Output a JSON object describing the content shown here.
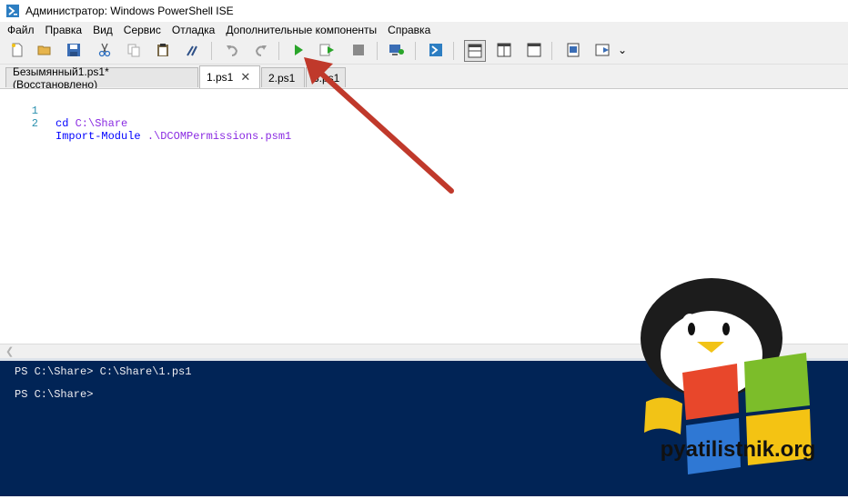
{
  "window": {
    "title": "Администратор: Windows PowerShell ISE"
  },
  "menu": [
    "Файл",
    "Правка",
    "Вид",
    "Сервис",
    "Отладка",
    "Дополнительные компоненты",
    "Справка"
  ],
  "toolbar": {
    "icons": [
      "new-file-icon",
      "open-file-icon",
      "save-icon",
      "cut-icon",
      "copy-icon",
      "paste-icon",
      "clear-icon",
      "undo-icon",
      "redo-icon",
      "run-script-icon",
      "run-selection-icon",
      "stop-icon",
      "new-remote-tab-icon",
      "powershell-console-icon",
      "show-script-top-icon",
      "show-script-right-icon",
      "show-script-max-icon",
      "show-command-window-icon",
      "show-command-addon-icon",
      "more-icon"
    ],
    "overflow_mark": "⌄"
  },
  "tabs": [
    {
      "label": "Безымянный1.ps1*(Восстановлено)",
      "active": false
    },
    {
      "label": "1.ps1",
      "active": true,
      "close": "✕"
    },
    {
      "label": "2.ps1",
      "active": false
    },
    {
      "label": "3.ps1",
      "active": false
    }
  ],
  "editor": {
    "lines": [
      {
        "number": "1",
        "keyword": "cd",
        "arg": "C:\\Share"
      },
      {
        "number": "2",
        "keyword": "Import-Module",
        "arg": ".\\DCOMPermissions.psm1"
      }
    ]
  },
  "console": {
    "lines": [
      "PS C:\\Share> C:\\Share\\1.ps1",
      "PS C:\\Share>"
    ]
  },
  "watermark": {
    "text": "pyatilistnik.org"
  },
  "colors": {
    "console_bg": "#012456",
    "annotation_arrow": "#c0392b",
    "run_green": "#2aa52a"
  }
}
